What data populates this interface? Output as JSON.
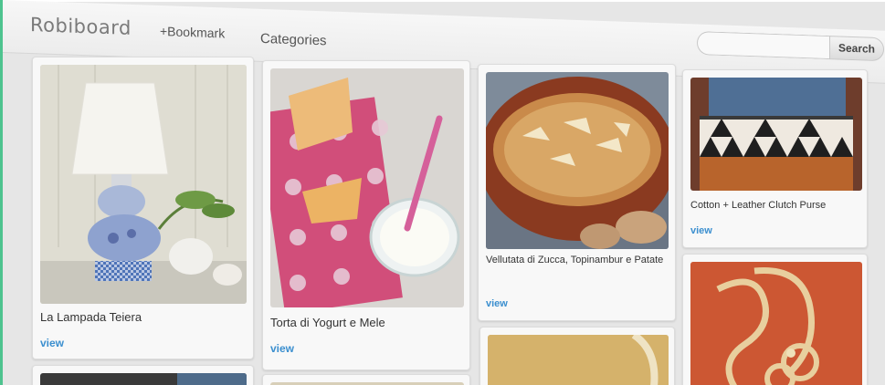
{
  "header": {
    "logo": "Robiboard",
    "bookmark_label": "+Bookmark",
    "categories_label": "Categories",
    "search_placeholder": "",
    "search_button": "Search"
  },
  "colors": {
    "accent_border": "#4ec38f",
    "link": "#3b8fcf"
  },
  "cards": [
    {
      "title": "La Lampada Teiera",
      "view": "view",
      "image": "teapot-lamp"
    },
    {
      "title": "Torta di Yogurt e Mele",
      "view": "view",
      "image": "cake-and-yogurt"
    },
    {
      "title": "Vellutata di Zucca, Topinambur e Patate",
      "view": "view",
      "image": "soup-bowl"
    },
    {
      "title": "Cotton + Leather Clutch Purse",
      "view": "view",
      "image": "clutch-purse"
    },
    {
      "title": "",
      "view": "",
      "image": "rope-necklace"
    },
    {
      "title": "",
      "view": "",
      "image": "dark-photo"
    },
    {
      "title": "",
      "view": "",
      "image": "food-photo"
    },
    {
      "title": "",
      "view": "",
      "image": "yellow-photo"
    }
  ]
}
